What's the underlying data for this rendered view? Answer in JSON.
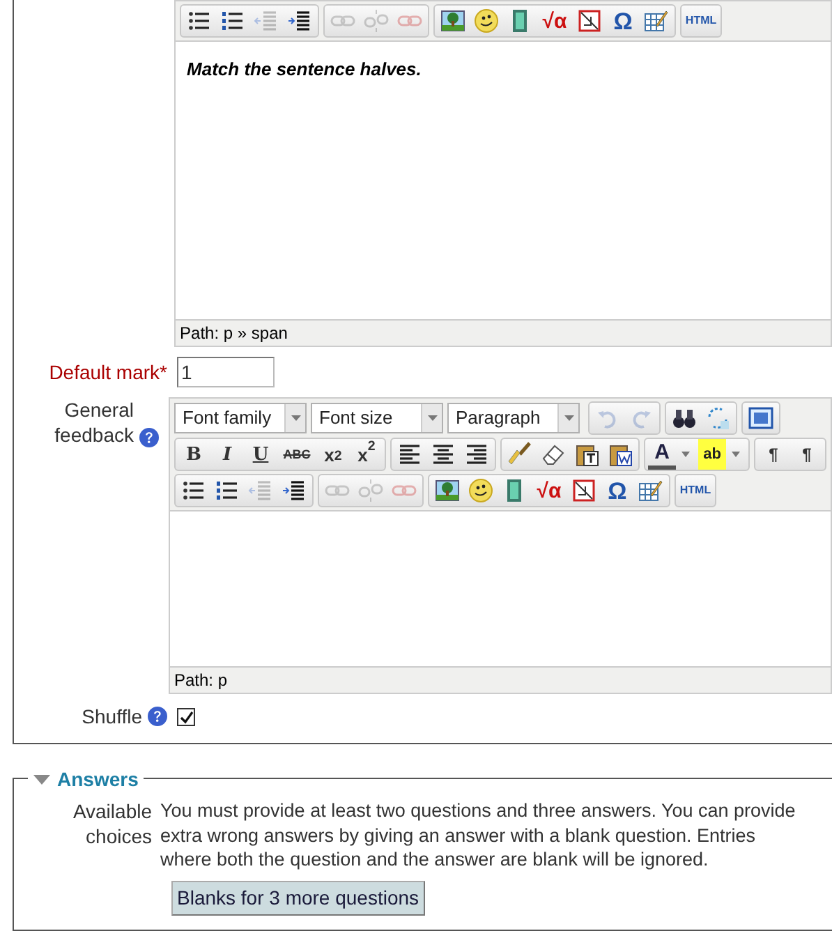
{
  "question_text_editor": {
    "toolbar_rows": [
      [
        [
          {
            "kind": "bullets",
            "disabled": false
          },
          {
            "kind": "numbers",
            "disabled": false
          },
          {
            "kind": "outdent",
            "disabled": true
          },
          {
            "kind": "indent",
            "disabled": false
          }
        ],
        [
          {
            "kind": "link",
            "disabled": true
          },
          {
            "kind": "unlink",
            "disabled": true
          },
          {
            "kind": "anchor",
            "disabled": true
          }
        ],
        [
          {
            "kind": "image",
            "disabled": false
          },
          {
            "kind": "emoticon",
            "disabled": false
          },
          {
            "kind": "media",
            "disabled": false
          },
          {
            "kind": "equation",
            "label": "√α",
            "disabled": false
          },
          {
            "kind": "nolink",
            "disabled": false
          },
          {
            "kind": "charmap",
            "label": "Ω",
            "disabled": false
          },
          {
            "kind": "table",
            "disabled": false
          }
        ],
        [
          {
            "kind": "html",
            "label": "HTML",
            "disabled": false
          }
        ]
      ]
    ],
    "content": "Match the sentence halves.",
    "path": "Path: p » span"
  },
  "default_mark": {
    "label": "Default mark",
    "required_mark": "*",
    "value": "1"
  },
  "general_feedback": {
    "label": "General feedback",
    "editor": {
      "toolbar_rows": [
        [
          [
            {
              "kind": "select",
              "label": "Font family"
            },
            {
              "kind": "select",
              "label": "Font size"
            },
            {
              "kind": "select",
              "label": "Paragraph"
            }
          ],
          [
            {
              "kind": "undo",
              "disabled": true
            },
            {
              "kind": "redo",
              "disabled": true
            }
          ],
          [
            {
              "kind": "search",
              "disabled": false
            },
            {
              "kind": "replace",
              "disabled": false
            }
          ],
          [
            {
              "kind": "fullscreen",
              "disabled": false
            }
          ]
        ],
        [
          [
            {
              "kind": "bold",
              "label": "B",
              "disabled": false
            },
            {
              "kind": "italic",
              "label": "I",
              "disabled": false
            },
            {
              "kind": "underline",
              "label": "U",
              "disabled": false
            },
            {
              "kind": "strike",
              "label": "ABC",
              "disabled": false
            },
            {
              "kind": "script",
              "label": "x$_{2}$",
              "disabled": false
            },
            {
              "kind": "script",
              "label": "x$^{2}$",
              "disabled": false
            }
          ],
          [
            {
              "kind": "alignleft",
              "disabled": false
            },
            {
              "kind": "aligncenter",
              "disabled": false
            },
            {
              "kind": "alignright",
              "disabled": false
            }
          ],
          [
            {
              "kind": "cleanup",
              "disabled": false
            },
            {
              "kind": "eraser",
              "disabled": false
            },
            {
              "kind": "pastetext",
              "disabled": false
            },
            {
              "kind": "pasteword",
              "disabled": false
            }
          ],
          [
            {
              "kind": "forecolor",
              "label": "A",
              "disabled": false
            },
            {
              "kind": "backcolor",
              "label": "ab",
              "disabled": false
            }
          ],
          [
            {
              "kind": "ltr",
              "label": "¶",
              "disabled": false
            },
            {
              "kind": "rtl",
              "label": "¶",
              "disabled": false
            }
          ]
        ],
        [
          [
            {
              "kind": "bullets",
              "disabled": false
            },
            {
              "kind": "numbers",
              "disabled": false
            },
            {
              "kind": "outdent",
              "disabled": true
            },
            {
              "kind": "indent",
              "disabled": false
            }
          ],
          [
            {
              "kind": "link",
              "disabled": true
            },
            {
              "kind": "unlink",
              "disabled": true
            },
            {
              "kind": "anchor",
              "disabled": true
            }
          ],
          [
            {
              "kind": "image",
              "disabled": false
            },
            {
              "kind": "emoticon",
              "disabled": false
            },
            {
              "kind": "media",
              "disabled": false
            },
            {
              "kind": "equation",
              "label": "√α",
              "disabled": false
            },
            {
              "kind": "nolink",
              "disabled": false
            },
            {
              "kind": "charmap",
              "label": "Ω",
              "disabled": false
            },
            {
              "kind": "table",
              "disabled": false
            }
          ],
          [
            {
              "kind": "html",
              "label": "HTML",
              "disabled": false
            }
          ]
        ]
      ],
      "path": "Path: p"
    }
  },
  "shuffle": {
    "label": "Shuffle",
    "checked": true
  },
  "answers": {
    "title": "Answers",
    "expanded": true,
    "label": "Available choices",
    "instructions": "You must provide at least two questions and three answers. You can provide extra wrong answers by giving an answer with a blank question. Entries where both the question and the answer are blank will be ignored.",
    "button": "Blanks for 3 more questions"
  }
}
